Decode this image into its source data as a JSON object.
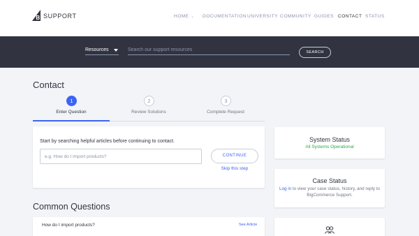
{
  "brand": {
    "name": "SUPPORT"
  },
  "nav": {
    "items": [
      {
        "label": "HOME"
      },
      {
        "label": "DOCUMENTATION"
      },
      {
        "label": "UNIVERSITY"
      },
      {
        "label": "COMMUNITY"
      },
      {
        "label": "GUIDES"
      },
      {
        "label": "CONTACT"
      },
      {
        "label": "STATUS"
      }
    ]
  },
  "search": {
    "scope": "Resources",
    "placeholder": "Search our support resources",
    "button": "SEARCH"
  },
  "page": {
    "title": "Contact"
  },
  "steps": [
    {
      "number": "1",
      "label": "Enter Question"
    },
    {
      "number": "2",
      "label": "Review Solutions"
    },
    {
      "number": "3",
      "label": "Complete Request"
    }
  ],
  "question_card": {
    "intro": "Start by searching helpful articles before continuing to contact.",
    "placeholder": "e.g. How do I import products?",
    "continue": "CONTINUE",
    "skip": "Skip this step"
  },
  "common_questions": {
    "title": "Common Questions",
    "items": [
      {
        "question": "How do I import products?",
        "link": "See Article"
      }
    ]
  },
  "system_status": {
    "title": "System Status",
    "status": "All Systems Operational"
  },
  "case_status": {
    "title": "Case Status",
    "login_link": "Log in",
    "text": " to view your case status, history, and reply to BigCommerce Support."
  },
  "colors": {
    "accent": "#3c64f4",
    "dark": "#313440",
    "success": "#2aab3f",
    "background": "#f2f4f7"
  },
  "icons": {
    "brand": "bigcommerce-logo",
    "people": "people-icon",
    "dropdown": "caret-down-icon"
  }
}
